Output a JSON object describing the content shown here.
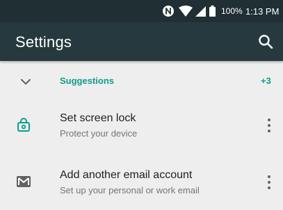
{
  "colors": {
    "status_bar": "#1f2f33",
    "app_bar": "#26393f",
    "background": "#eeeeee",
    "accent": "#0d9e8a",
    "primary_text": "#212121",
    "secondary_text": "#757575"
  },
  "status_bar": {
    "icons": [
      "nfc-icon",
      "wifi-icon",
      "cell-signal-icon",
      "battery-icon"
    ],
    "battery_percent": "100%",
    "time": "1:13 PM"
  },
  "app_bar": {
    "title": "Settings",
    "search_icon": "search-icon"
  },
  "suggestions": {
    "icon": "chevron-down-icon",
    "label": "Suggestions",
    "count": "+3"
  },
  "items": [
    {
      "icon": "lock-icon",
      "title": "Set screen lock",
      "subtitle": "Protect your device",
      "menu_icon": "more-vert-icon"
    },
    {
      "icon": "email-icon",
      "title": "Add another email account",
      "subtitle": "Set up your personal or work email",
      "menu_icon": "more-vert-icon"
    }
  ]
}
